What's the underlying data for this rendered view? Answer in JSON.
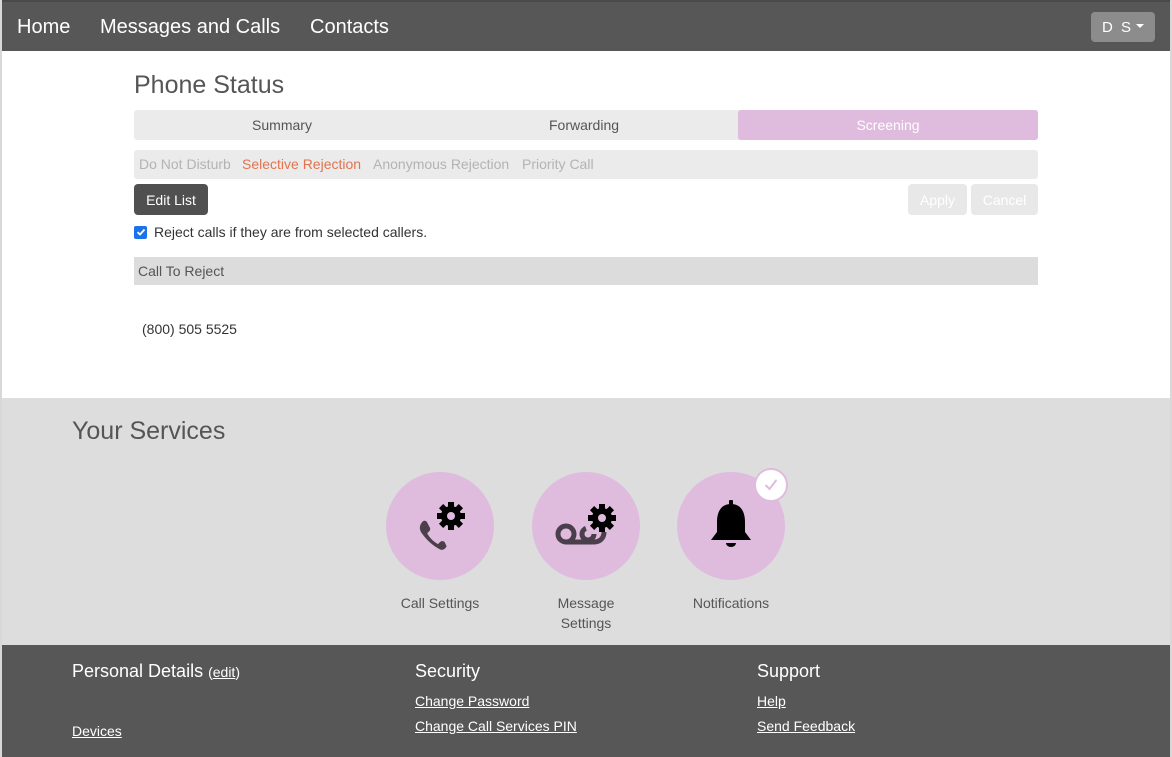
{
  "nav": {
    "items": [
      {
        "label": "Home"
      },
      {
        "label": "Messages and Calls"
      },
      {
        "label": "Contacts"
      }
    ],
    "user_initials": "D S"
  },
  "phone_status": {
    "title": "Phone Status",
    "tabs": [
      {
        "label": "Summary",
        "active": false
      },
      {
        "label": "Forwarding",
        "active": false
      },
      {
        "label": "Screening",
        "active": true
      }
    ],
    "subtabs": [
      {
        "label": "Do Not Disturb",
        "active": false
      },
      {
        "label": "Selective Rejection",
        "active": true
      },
      {
        "label": "Anonymous Rejection",
        "active": false
      },
      {
        "label": "Priority Call",
        "active": false
      }
    ],
    "edit_list_label": "Edit List",
    "apply_label": "Apply",
    "cancel_label": "Cancel",
    "reject_checkbox": {
      "label": "Reject calls if they are from selected callers.",
      "checked": true
    },
    "table": {
      "header": "Call To Reject",
      "rows": [
        "(800) 505 5525"
      ]
    }
  },
  "services": {
    "title": "Your Services",
    "items": [
      {
        "label": "Call Settings",
        "icon": "phone-gear-icon"
      },
      {
        "label": "Message Settings",
        "icon": "voicemail-gear-icon"
      },
      {
        "label": "Notifications",
        "icon": "bell-icon",
        "checked": true
      }
    ]
  },
  "footer": {
    "personal": {
      "heading": "Personal Details",
      "edit_label": "edit",
      "links": [
        "Devices"
      ]
    },
    "security": {
      "heading": "Security",
      "links": [
        "Change Password",
        "Change Call Services PIN"
      ]
    },
    "support": {
      "heading": "Support",
      "links": [
        "Help",
        "Send Feedback"
      ]
    }
  },
  "colors": {
    "accent": "#dfbbde",
    "active_subtab": "#e2734f",
    "nav_bg": "#575757",
    "checkbox": "#1a73e8"
  }
}
